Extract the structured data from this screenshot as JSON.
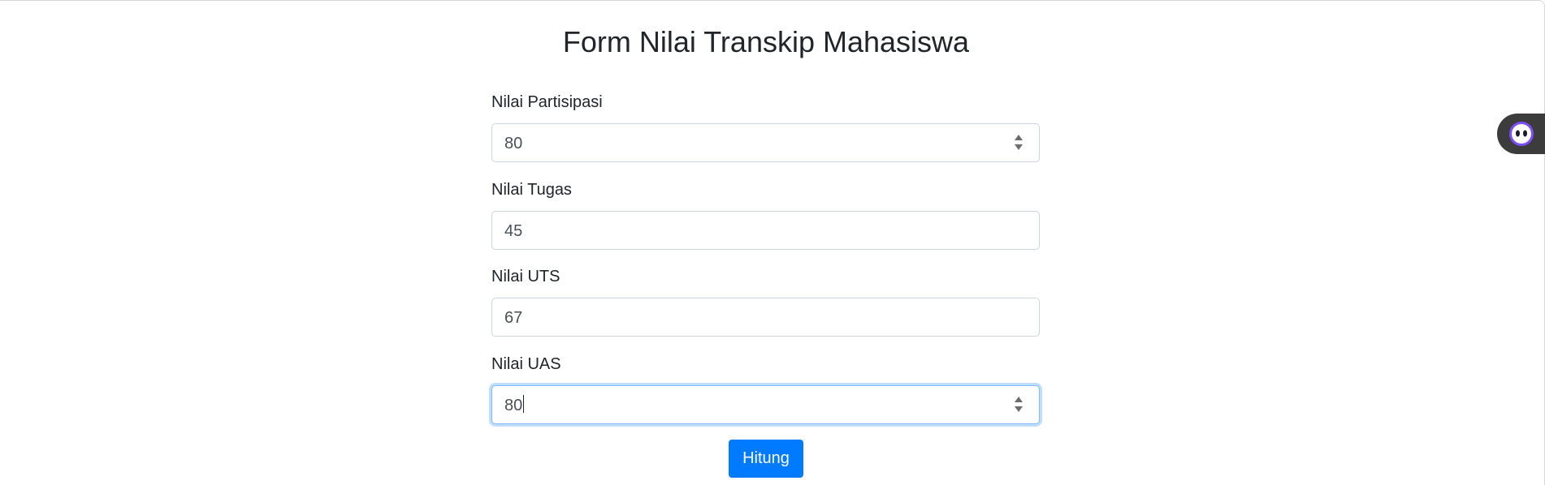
{
  "page": {
    "title": "Form Nilai Transkip Mahasiswa"
  },
  "form": {
    "fields": [
      {
        "label": "Nilai Partisipasi",
        "value": "80",
        "type": "number",
        "focused": false
      },
      {
        "label": "Nilai Tugas",
        "value": "45",
        "type": "text",
        "focused": false
      },
      {
        "label": "Nilai UTS",
        "value": "67",
        "type": "text",
        "focused": false
      },
      {
        "label": "Nilai UAS",
        "value": "80",
        "type": "number",
        "focused": true
      }
    ],
    "submit_label": "Hitung"
  },
  "colors": {
    "primary": "#007bff",
    "focus_border": "#80bdff",
    "input_border": "#ced4da",
    "text": "#212529",
    "widget_bg": "#3c3c3c",
    "widget_icon": "#7c4dff"
  },
  "icons": {
    "side_widget": "bot-face-icon",
    "spinner_up": "triangle-up-icon",
    "spinner_down": "triangle-down-icon"
  }
}
